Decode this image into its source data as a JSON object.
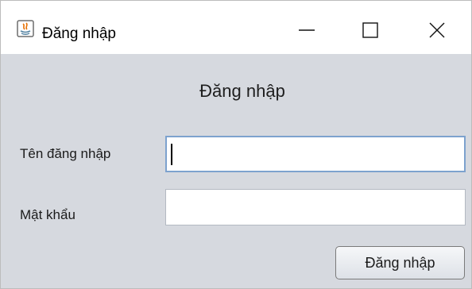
{
  "window": {
    "title": "Đăng nhập",
    "icon": "java-app-icon",
    "controls": {
      "minimize": "minimize-icon",
      "maximize": "maximize-icon",
      "close": "close-icon"
    }
  },
  "form": {
    "heading": "Đăng nhập",
    "username_label": "Tên đăng nhập",
    "username_value": "",
    "password_label": "Mật khẩu",
    "password_value": "",
    "submit_label": "Đăng nhập"
  },
  "colors": {
    "background": "#d6d9df",
    "focus_border": "#7da2ce"
  }
}
